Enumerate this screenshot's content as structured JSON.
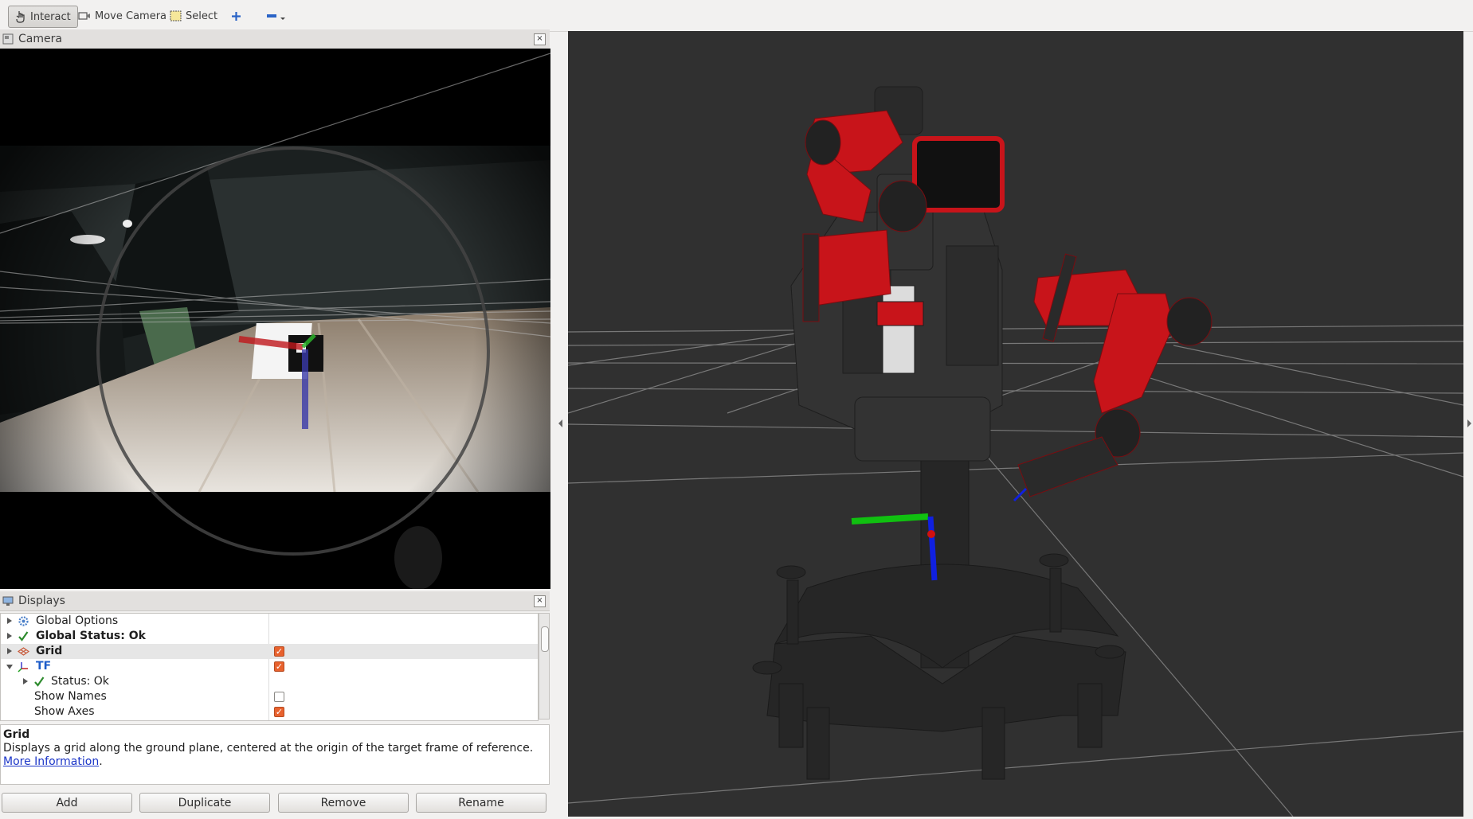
{
  "toolbar": {
    "tools": [
      {
        "label": "Interact",
        "icon": "hand-pointer-icon",
        "active": true
      },
      {
        "label": "Move Camera",
        "icon": "move-camera-icon",
        "active": false
      },
      {
        "label": "Select",
        "icon": "select-box-icon",
        "active": false
      },
      {
        "label": "",
        "icon": "plus-icon",
        "active": false
      },
      {
        "label": "",
        "icon": "minus-dropdown-icon",
        "active": false
      }
    ]
  },
  "camera_panel": {
    "title": "Camera"
  },
  "displays_panel": {
    "title": "Displays",
    "rows": [
      {
        "label": "Global Options",
        "expand": "collapsed",
        "icon": "gear-icon",
        "indent": 0,
        "bold": false,
        "blue": false,
        "checkbox": null
      },
      {
        "label": "Global Status: Ok",
        "expand": "collapsed",
        "icon": "check-icon",
        "indent": 0,
        "bold": true,
        "blue": false,
        "checkbox": null
      },
      {
        "label": "Grid",
        "expand": "collapsed",
        "icon": "grid-icon",
        "indent": 0,
        "bold": true,
        "blue": false,
        "checkbox": true,
        "selected": true
      },
      {
        "label": "TF",
        "expand": "expanded",
        "icon": "tf-icon",
        "indent": 0,
        "bold": true,
        "blue": true,
        "checkbox": true
      },
      {
        "label": "Status: Ok",
        "expand": "collapsed",
        "icon": "check-icon",
        "indent": 1,
        "bold": false,
        "blue": false,
        "checkbox": null
      },
      {
        "label": "Show Names",
        "expand": "none",
        "icon": null,
        "indent": 1,
        "bold": false,
        "blue": false,
        "checkbox": false
      },
      {
        "label": "Show Axes",
        "expand": "none",
        "icon": null,
        "indent": 1,
        "bold": false,
        "blue": false,
        "checkbox": true
      }
    ]
  },
  "description": {
    "title": "Grid",
    "text": "Displays a grid along the ground plane, centered at the origin of the target frame of reference.",
    "link_text": "More Information",
    "suffix": "."
  },
  "buttons": {
    "add": "Add",
    "duplicate": "Duplicate",
    "remove": "Remove",
    "rename": "Rename"
  },
  "colors": {
    "background": "#f2f1f0",
    "render_background": "#303030",
    "robot_red": "#c8141a",
    "checkbox_accent": "#e8622e",
    "link": "#1c36c8"
  }
}
